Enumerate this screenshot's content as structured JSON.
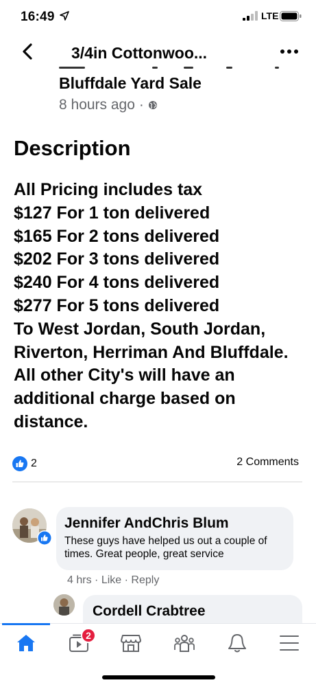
{
  "status_bar": {
    "time": "16:49",
    "network": "LTE"
  },
  "header": {
    "title": "3/4in Cottonwoo...",
    "back_icon": "chevron-left-icon",
    "more_icon": "more-horizontal-icon"
  },
  "post": {
    "group_name": "Bluffdale Yard Sale",
    "time_ago": "8 hours ago",
    "dot": "·",
    "privacy_icon": "globe-icon",
    "description_heading": "Description",
    "description_lines": [
      "All Pricing includes tax",
      "$127 For 1 ton delivered",
      "$165 For 2 tons delivered",
      "$202 For 3 tons delivered",
      "$240 For 4 tons delivered",
      "$277 For 5 tons delivered",
      "To West Jordan, South Jordan, Riverton, Herriman And Bluffdale. All other City's will have an additional charge based on distance."
    ],
    "like_count": "2",
    "comments_count": "2 Comments"
  },
  "comments": [
    {
      "author": "Jennifer AndChris Blum",
      "text": "These guys have helped us out a couple of times. Great people, great service",
      "time": "4 hrs",
      "like_label": "Like",
      "reply_label": "Reply"
    },
    {
      "author": "Cordell Crabtree"
    }
  ],
  "tab_bar": {
    "tabs": [
      {
        "name": "home",
        "icon": "home-icon"
      },
      {
        "name": "watch",
        "icon": "video-icon",
        "badge": "2"
      },
      {
        "name": "marketplace",
        "icon": "marketplace-icon"
      },
      {
        "name": "groups",
        "icon": "groups-icon"
      },
      {
        "name": "notifications",
        "icon": "bell-icon"
      },
      {
        "name": "menu",
        "icon": "menu-icon"
      }
    ],
    "accent": "#1877f2"
  },
  "colors": {
    "accent": "#1877f2",
    "badge": "#e41e3f",
    "secondary_text": "#65676b",
    "bubble": "#f0f2f5"
  }
}
